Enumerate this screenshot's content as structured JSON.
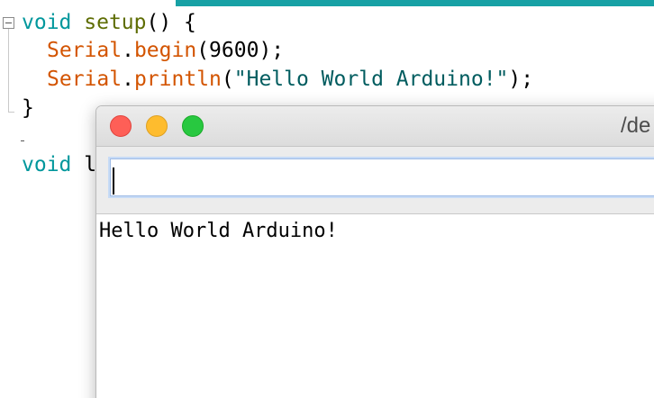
{
  "editor": {
    "accent_color": "#17a1a5",
    "lines": [
      {
        "type": "void",
        "name": "setup",
        "rest": "() {"
      },
      {
        "object": "Serial",
        "method": "begin",
        "args": "(9600);"
      },
      {
        "object": "Serial",
        "method": "println",
        "open": "(",
        "string": "\"Hello World Arduino!\"",
        "close": ");"
      },
      {
        "text": "}"
      },
      {
        "type": "void",
        "partial": "l"
      }
    ],
    "syntax_colors": {
      "type": "#00979c",
      "function": "#5e6d03",
      "object": "#d35400",
      "string": "#005c5f"
    },
    "fold_icon": "collapse-minus-icon"
  },
  "serial_monitor": {
    "title": "/de",
    "send_input": {
      "value": "",
      "placeholder": ""
    },
    "output": [
      "Hello World Arduino!"
    ],
    "window_controls": {
      "close": "#fe5f57",
      "minimize": "#febc2e",
      "zoom": "#28c840"
    }
  }
}
